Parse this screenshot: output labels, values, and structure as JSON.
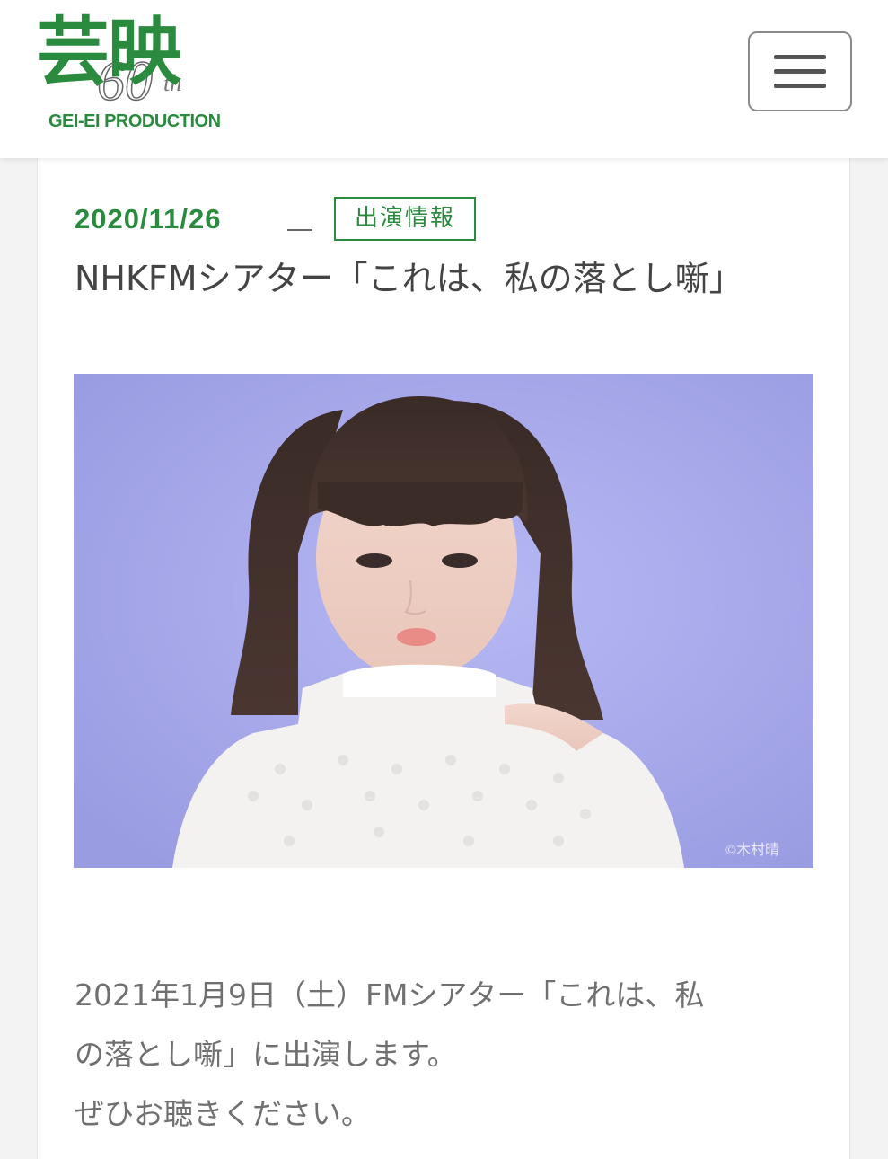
{
  "header": {
    "logo": {
      "kanji": "芸映",
      "anniversary_number": "60",
      "anniversary_suffix": "th",
      "subtitle": "GEI-EI PRODUCTION"
    },
    "menu_icon": "hamburger-menu-icon"
  },
  "article": {
    "date": "2020/11/26",
    "category": "出演情報",
    "title": "NHKFMシアター「これは、私の落とし噺」",
    "photo_credit": "©木村晴",
    "body": [
      "2021年1月9日（土）FMシアター「これは、私",
      "の落とし噺」に出演します。",
      "ぜひお聴きください。"
    ]
  },
  "colors": {
    "brand_green": "#2a8a3e",
    "text_gray": "#707070",
    "photo_background": "#a6a8ee"
  }
}
